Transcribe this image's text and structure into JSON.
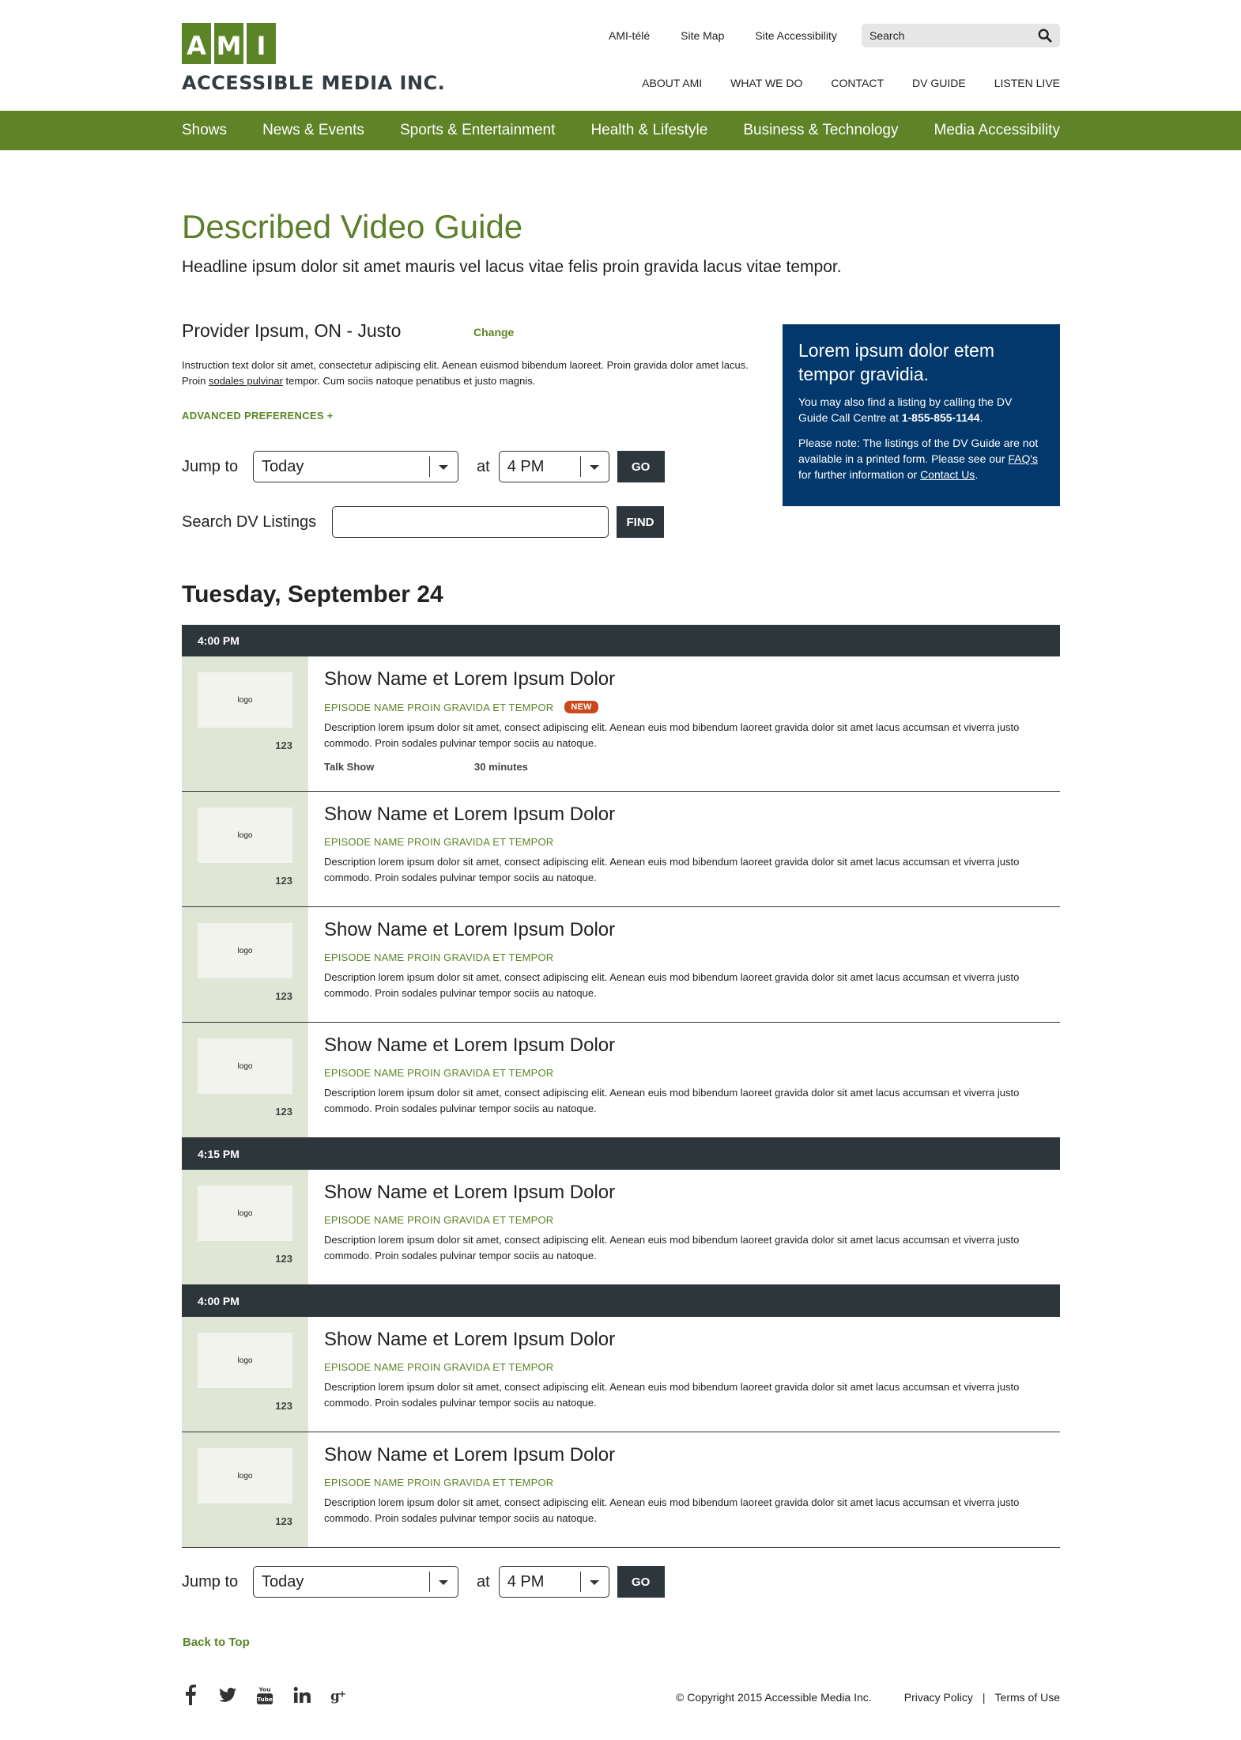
{
  "brand": {
    "letters": [
      "A",
      "M",
      "I"
    ],
    "name": "ACCESSIBLE MEDIA INC."
  },
  "utility_nav": [
    "AMI-télé",
    "Site Map",
    "Site Accessibility"
  ],
  "search": {
    "placeholder": "Search"
  },
  "main_nav": [
    "ABOUT AMI",
    "WHAT WE DO",
    "CONTACT",
    "DV GUIDE",
    "LISTEN LIVE"
  ],
  "category_nav": [
    "Shows",
    "News & Events",
    "Sports & Entertainment",
    "Health & Lifestyle",
    "Business & Technology",
    "Media Accessibility"
  ],
  "page": {
    "title": "Described Video Guide",
    "headline": "Headline ipsum dolor sit amet mauris vel lacus vitae felis proin gravida lacus vitae tempor."
  },
  "provider": {
    "name": "Provider Ipsum, ON - Justo",
    "change_label": "Change",
    "instruction_pre": "Instruction text dolor sit amet, consectetur adipiscing elit. Aenean euismod bibendum laoreet. Proin gravida dolor amet lacus. Proin ",
    "instruction_link": "sodales pulvinar",
    "instruction_post": " tempor. Cum sociis natoque penatibus et justo magnis.",
    "advanced_label": "ADVANCED PREFERENCES  +"
  },
  "jump": {
    "label": "Jump to",
    "day": "Today",
    "at_label": "at",
    "time": "4 PM",
    "go_label": "GO"
  },
  "search_listings": {
    "label": "Search DV Listings",
    "value": "",
    "find_label": "FIND"
  },
  "callout": {
    "title": "Lorem ipsum dolor etem tempor gravidia.",
    "p1_pre": "You may also find a listing by calling the DV Guide Call Centre at ",
    "phone": "1-855-855-1144",
    "p1_post": ".",
    "p2_pre": "Please note: The listings of the DV Guide are not available in a printed form. Please see our ",
    "faq_link": "FAQ's",
    "p2_mid": " for further information or ",
    "contact_link": "Contact Us",
    "p2_post": "."
  },
  "date_heading": "Tuesday, September 24",
  "listing_groups": [
    {
      "time": "4:00 PM",
      "shows": [
        {
          "name": "Show Name et Lorem Ipsum Dolor",
          "episode": "EPISODE NAME PROIN GRAVIDA ET TEMPOR",
          "badge": "NEW",
          "description": "Description lorem ipsum dolor sit amet, consect adipiscing elit. Aenean euis mod bibendum laoreet gravida dolor sit amet lacus accumsan et viverra justo commodo. Proin sodales pulvinar tempor sociis au natoque.",
          "genre": "Talk Show",
          "duration": "30 minutes",
          "logo": "logo",
          "channel": "123"
        },
        {
          "name": "Show Name et Lorem Ipsum Dolor",
          "episode": "EPISODE NAME PROIN GRAVIDA ET TEMPOR",
          "description": "Description lorem ipsum dolor sit amet, consect adipiscing elit. Aenean euis mod bibendum laoreet gravida dolor sit amet lacus accumsan et viverra justo commodo. Proin sodales pulvinar tempor sociis au natoque.",
          "logo": "logo",
          "channel": "123"
        },
        {
          "name": "Show Name et Lorem Ipsum Dolor",
          "episode": "EPISODE NAME PROIN GRAVIDA ET TEMPOR",
          "description": "Description lorem ipsum dolor sit amet, consect adipiscing elit. Aenean euis mod bibendum laoreet gravida dolor sit amet lacus accumsan et viverra justo commodo. Proin sodales pulvinar tempor sociis au natoque.",
          "logo": "logo",
          "channel": "123"
        },
        {
          "name": "Show Name et Lorem Ipsum Dolor",
          "episode": "EPISODE NAME PROIN GRAVIDA ET TEMPOR",
          "description": "Description lorem ipsum dolor sit amet, consect adipiscing elit. Aenean euis mod bibendum laoreet gravida dolor sit amet lacus accumsan et viverra justo commodo. Proin sodales pulvinar tempor sociis au natoque.",
          "logo": "logo",
          "channel": "123"
        }
      ]
    },
    {
      "time": "4:15 PM",
      "shows": [
        {
          "name": "Show Name et Lorem Ipsum Dolor",
          "episode": "EPISODE NAME PROIN GRAVIDA ET TEMPOR",
          "description": "Description lorem ipsum dolor sit amet, consect adipiscing elit. Aenean euis mod bibendum laoreet gravida dolor sit amet lacus accumsan et viverra justo commodo. Proin sodales pulvinar tempor sociis au natoque.",
          "logo": "logo",
          "channel": "123"
        }
      ]
    },
    {
      "time": "4:00 PM",
      "shows": [
        {
          "name": "Show Name et Lorem Ipsum Dolor",
          "episode": "EPISODE NAME PROIN GRAVIDA ET TEMPOR",
          "description": "Description lorem ipsum dolor sit amet, consect adipiscing elit. Aenean euis mod bibendum laoreet gravida dolor sit amet lacus accumsan et viverra justo commodo. Proin sodales pulvinar tempor sociis au natoque.",
          "logo": "logo",
          "channel": "123"
        },
        {
          "name": "Show Name et Lorem Ipsum Dolor",
          "episode": "EPISODE NAME PROIN GRAVIDA ET TEMPOR",
          "description": "Description lorem ipsum dolor sit amet, consect adipiscing elit. Aenean euis mod bibendum laoreet gravida dolor sit amet lacus accumsan et viverra justo commodo. Proin sodales pulvinar tempor sociis au natoque.",
          "logo": "logo",
          "channel": "123"
        }
      ]
    }
  ],
  "back_to_top": "Back to Top",
  "social": [
    "facebook-icon",
    "twitter-icon",
    "youtube-icon",
    "linkedin-icon",
    "google-plus-icon"
  ],
  "footer": {
    "copyright": "© Copyright 2015 Accessible Media Inc.",
    "privacy": "Privacy Policy",
    "separator": "|",
    "terms": "Terms of Use"
  },
  "colors": {
    "brand_green": "#5e8427",
    "dark": "#2d373b",
    "callout_blue": "#02386b",
    "new_badge": "#c9481c",
    "logo_column": "#dfe6d5"
  }
}
